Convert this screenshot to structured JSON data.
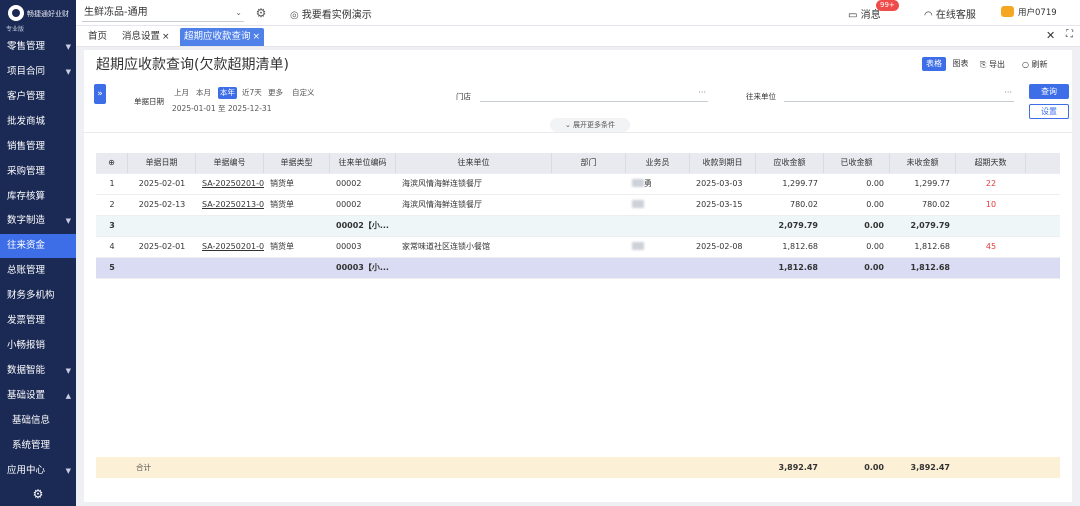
{
  "app": {
    "brand": "畅捷通好业财",
    "edition": "专业版"
  },
  "sidebar": {
    "items": [
      {
        "label": "零售管理",
        "chevron": "▼"
      },
      {
        "label": "项目合同",
        "chevron": "▼"
      },
      {
        "label": "客户管理",
        "chevron": ""
      },
      {
        "label": "批发商城",
        "chevron": ""
      },
      {
        "label": "销售管理",
        "chevron": ""
      },
      {
        "label": "采购管理",
        "chevron": ""
      },
      {
        "label": "库存核算",
        "chevron": ""
      },
      {
        "label": "数字制造",
        "chevron": "▼"
      },
      {
        "label": "往来资金",
        "chevron": ""
      },
      {
        "label": "总账管理",
        "chevron": ""
      },
      {
        "label": "财务多机构",
        "chevron": ""
      },
      {
        "label": "发票管理",
        "chevron": ""
      },
      {
        "label": "小畅报销",
        "chevron": ""
      },
      {
        "label": "数据智能",
        "chevron": "▼"
      },
      {
        "label": "基础设置",
        "chevron": "▲"
      },
      {
        "label": "基础信息",
        "chevron": ""
      },
      {
        "label": "系统管理",
        "chevron": ""
      },
      {
        "label": "应用中心",
        "chevron": "▼"
      }
    ],
    "gear_icon": "⚙"
  },
  "topbar": {
    "store_selector": "生鲜冻品-通用",
    "demo_link": "我要看实例演示",
    "messages_label": "消息",
    "messages_badge": "99+",
    "service_label": "在线客服",
    "user_label": "用户0719"
  },
  "tabs": [
    {
      "label": "首页",
      "closable": false
    },
    {
      "label": "消息设置",
      "closable": true
    },
    {
      "label": "超期应收款查询",
      "closable": true
    }
  ],
  "page": {
    "title": "超期应收款查询(欠款超期清单)",
    "view_table": "表格",
    "view_chart": "图表",
    "export": "导出",
    "refresh": "刷新"
  },
  "filters": {
    "date_label": "单据日期",
    "quick_periods": [
      "上月",
      "本月",
      "本年",
      "近7天",
      "更多",
      "自定义"
    ],
    "active_period": "本年",
    "date_start": "2025-01-01",
    "date_sep": "至",
    "date_end": "2025-12-31",
    "store_label": "门店",
    "store_value": "",
    "partner_label": "往来单位",
    "partner_value": "",
    "query": "查询",
    "settings": "设置",
    "more_conditions": "展开更多条件"
  },
  "table": {
    "columns": [
      "⊕",
      "单据日期",
      "单据编号",
      "单据类型",
      "往来单位编码",
      "往来单位",
      "部门",
      "业务员",
      "收款到期日",
      "应收金额",
      "已收金额",
      "未收金额",
      "超期天数"
    ],
    "rows": [
      {
        "no": "1",
        "date": "2025-02-01",
        "doc_no": "SA-20250201-0",
        "doc_type": "销货单",
        "partner_code": "00002",
        "partner": "海滨风情海鲜连锁餐厅",
        "dept": "",
        "sales": "",
        "sales_suffix": "勇",
        "due": "2025-03-03",
        "receivable": "1,299.77",
        "received": "0.00",
        "unreceived": "1,299.77",
        "overdue": "22",
        "kind": "detail"
      },
      {
        "no": "2",
        "date": "2025-02-13",
        "doc_no": "SA-20250213-0",
        "doc_type": "销货单",
        "partner_code": "00002",
        "partner": "海滨风情海鲜连锁餐厅",
        "dept": "",
        "sales": "",
        "sales_suffix": "",
        "due": "2025-03-15",
        "receivable": "780.02",
        "received": "0.00",
        "unreceived": "780.02",
        "overdue": "10",
        "kind": "detail"
      },
      {
        "no": "3",
        "date": "",
        "doc_no": "",
        "doc_type": "",
        "partner_code": "00002【小...",
        "partner": "",
        "dept": "",
        "sales": "",
        "sales_suffix": "",
        "due": "",
        "receivable": "2,079.79",
        "received": "0.00",
        "unreceived": "2,079.79",
        "overdue": "",
        "kind": "sum"
      },
      {
        "no": "4",
        "date": "2025-02-01",
        "doc_no": "SA-20250201-0",
        "doc_type": "销货单",
        "partner_code": "00003",
        "partner": "家常味道社区连锁小餐馆",
        "dept": "",
        "sales": "",
        "sales_suffix": "",
        "due": "2025-02-08",
        "receivable": "1,812.68",
        "received": "0.00",
        "unreceived": "1,812.68",
        "overdue": "45",
        "kind": "detail"
      },
      {
        "no": "5",
        "date": "",
        "doc_no": "",
        "doc_type": "",
        "partner_code": "00003【小...",
        "partner": "",
        "dept": "",
        "sales": "",
        "sales_suffix": "",
        "due": "",
        "receivable": "1,812.68",
        "received": "0.00",
        "unreceived": "1,812.68",
        "overdue": "",
        "kind": "sum-selected"
      }
    ],
    "total": {
      "label": "合计",
      "receivable": "3,892.47",
      "received": "0.00",
      "unreceived": "3,892.47"
    }
  },
  "colors": {
    "sidebar_bg": "#1b2a55",
    "accent": "#3d6ee8",
    "overdue_red": "#e23b3b",
    "total_bar": "#fcf0d6"
  }
}
